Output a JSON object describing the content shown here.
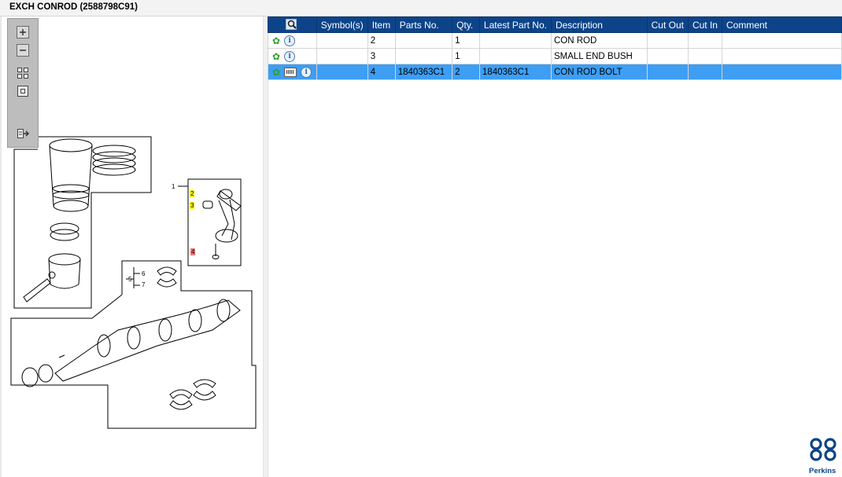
{
  "window": {
    "title": "EXCH CONROD (2588798C91)"
  },
  "viewer": {
    "toolbar": [
      {
        "name": "zoom-in-icon"
      },
      {
        "name": "zoom-out-icon"
      },
      {
        "name": "fit-all-icon"
      },
      {
        "name": "actual-size-icon"
      },
      {
        "name": "export-icon"
      }
    ],
    "callouts": {
      "c1": "1",
      "c2": "2",
      "c3": "3",
      "c4": "4",
      "c5": "5",
      "c6": "6",
      "c7": "7"
    }
  },
  "grid": {
    "headers": [
      "Symbol(s)",
      "Item",
      "Parts No.",
      "Qty.",
      "Latest Part No.",
      "Description",
      "Cut Out",
      "Cut In",
      "Comment"
    ],
    "rows": [
      {
        "icons": [
          "gear-icon",
          "info-icon"
        ],
        "item": "2",
        "parts_no": "",
        "qty": "1",
        "latest_part_no": "",
        "description": "CON ROD",
        "cut_out": "",
        "cut_in": "",
        "comment": ""
      },
      {
        "icons": [
          "gear-icon",
          "info-icon"
        ],
        "item": "3",
        "parts_no": "",
        "qty": "1",
        "latest_part_no": "",
        "description": "SMALL END BUSH",
        "cut_out": "",
        "cut_in": "",
        "comment": ""
      },
      {
        "icons": [
          "gear-icon",
          "scan-icon",
          "info-icon"
        ],
        "item": "4",
        "parts_no": "1840363C1",
        "qty": "2",
        "latest_part_no": "1840363C1",
        "description": "CON ROD BOLT",
        "cut_out": "",
        "cut_in": "",
        "comment": "",
        "selected": true
      }
    ],
    "colors": {
      "header": "#0d4489",
      "selected_row": "#3d9ef4",
      "gear": "#2f9e2f"
    }
  },
  "brand": {
    "name": "Perkins"
  }
}
